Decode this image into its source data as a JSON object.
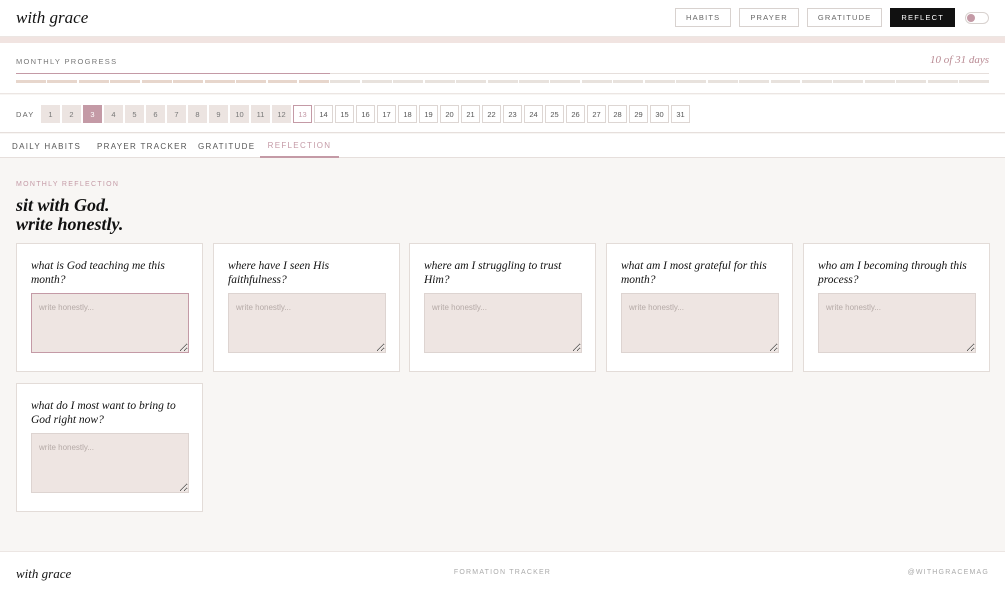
{
  "header": {
    "brand": "with grace",
    "nav": [
      "HABITS",
      "PRAYER",
      "GRATITUDE",
      "REFLECT"
    ],
    "active_nav": "REFLECT",
    "toggle_state": "off"
  },
  "progress": {
    "label": "MONTHLY PROGRESS",
    "days_text": "10 of 31 days",
    "completed_days": 10,
    "total_days": 31
  },
  "day_selector": {
    "label": "DAY",
    "days": [
      "1",
      "2",
      "3",
      "4",
      "5",
      "6",
      "7",
      "8",
      "9",
      "10",
      "11",
      "12",
      "13",
      "14",
      "15",
      "16",
      "17",
      "18",
      "19",
      "20",
      "21",
      "22",
      "23",
      "24",
      "25",
      "26",
      "27",
      "28",
      "29",
      "30",
      "31"
    ],
    "selected": "3",
    "today": "13"
  },
  "tabs": [
    "DAILY HABITS",
    "PRAYER TRACKER",
    "GRATITUDE",
    "REFLECTION"
  ],
  "active_tab": "REFLECTION",
  "reflection": {
    "eyebrow": "MONTHLY REFLECTION",
    "heading_line1": "sit with God.",
    "heading_line2": "write honestly.",
    "placeholder": "write honestly...",
    "questions": [
      "what is God teaching me this month?",
      "where have I seen His faithfulness?",
      "where am I struggling to trust Him?",
      "what am I most grateful for this month?",
      "who am I becoming through this process?",
      "what do I most want to bring to God right now?"
    ]
  },
  "footer": {
    "brand": "with grace",
    "center": "FORMATION TRACKER",
    "right": "@WITHGRACEMAG"
  },
  "colors": {
    "accent": "#c49aa6",
    "textarea_bg": "#eee5e2",
    "active_nav_bg": "#111111"
  }
}
